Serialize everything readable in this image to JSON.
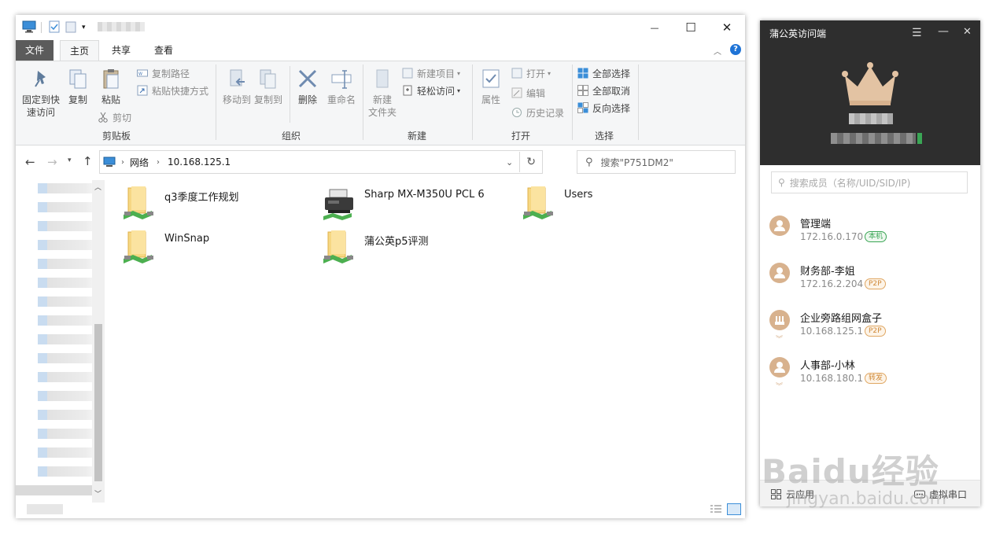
{
  "explorer": {
    "title_blurred": "",
    "window_controls": {
      "minimize": "—",
      "maximize": "☐",
      "close": "✕"
    },
    "menu_tabs": [
      {
        "label": "文件"
      },
      {
        "label": "主页"
      },
      {
        "label": "共享"
      },
      {
        "label": "查看"
      }
    ],
    "help_icon": "?",
    "ribbon": {
      "clipboard": {
        "pin_label_1": "固定到快",
        "pin_label_2": "速访问",
        "copy": "复制",
        "paste": "粘贴",
        "copy_path": "复制路径",
        "paste_shortcut": "粘贴快捷方式",
        "cut": "剪切",
        "group": "剪贴板"
      },
      "organize": {
        "move_to": "移动到",
        "copy_to": "复制到",
        "delete": "删除",
        "rename": "重命名",
        "group": "组织"
      },
      "new": {
        "new_folder_1": "新建",
        "new_folder_2": "文件夹",
        "new_item": "新建项目",
        "easy_access": "轻松访问",
        "group": "新建"
      },
      "open": {
        "properties": "属性",
        "open": "打开",
        "edit": "编辑",
        "history": "历史记录",
        "group": "打开"
      },
      "select": {
        "select_all": "全部选择",
        "select_none": "全部取消",
        "invert": "反向选择",
        "group": "选择"
      }
    },
    "address": {
      "crumb_1": "网络",
      "crumb_2": "10.168.125.1",
      "search_placeholder": "搜索\"P751DM2\""
    },
    "files": [
      {
        "name": "q3季度工作规划",
        "type": "shared-folder"
      },
      {
        "name": "Sharp MX-M350U PCL 6",
        "type": "printer"
      },
      {
        "name": "Users",
        "type": "shared-folder"
      },
      {
        "name": "WinSnap",
        "type": "shared-folder"
      },
      {
        "name": "蒲公英p5评测",
        "type": "shared-folder"
      }
    ]
  },
  "pgy": {
    "title": "蒲公英访问端",
    "search_placeholder": "搜索成员（名称/UID/SID/IP)",
    "members": [
      {
        "name": "管理端",
        "ip": "172.16.0.170",
        "tag": "本机",
        "tag_color": "#3aa655",
        "icon": "user-avatar-icon"
      },
      {
        "name": "财务部-李姐",
        "ip": "172.16.2.204",
        "tag": "P2P",
        "tag_color": "#d08a3a",
        "icon": "user-avatar-icon"
      },
      {
        "name": "企业旁路组网盒子",
        "ip": "10.168.125.1",
        "tag": "P2P",
        "tag_color": "#d08a3a",
        "icon": "router-icon"
      },
      {
        "name": "人事部-小林",
        "ip": "10.168.180.1",
        "tag": "转发",
        "tag_color": "#d08a3a",
        "icon": "user-avatar-icon"
      }
    ],
    "bottom": {
      "cloud_app": "云应用",
      "virtual_serial": "虚拟串口"
    }
  },
  "watermark": {
    "brand": "Baidu经验",
    "url": "jingyan.baidu.com"
  }
}
